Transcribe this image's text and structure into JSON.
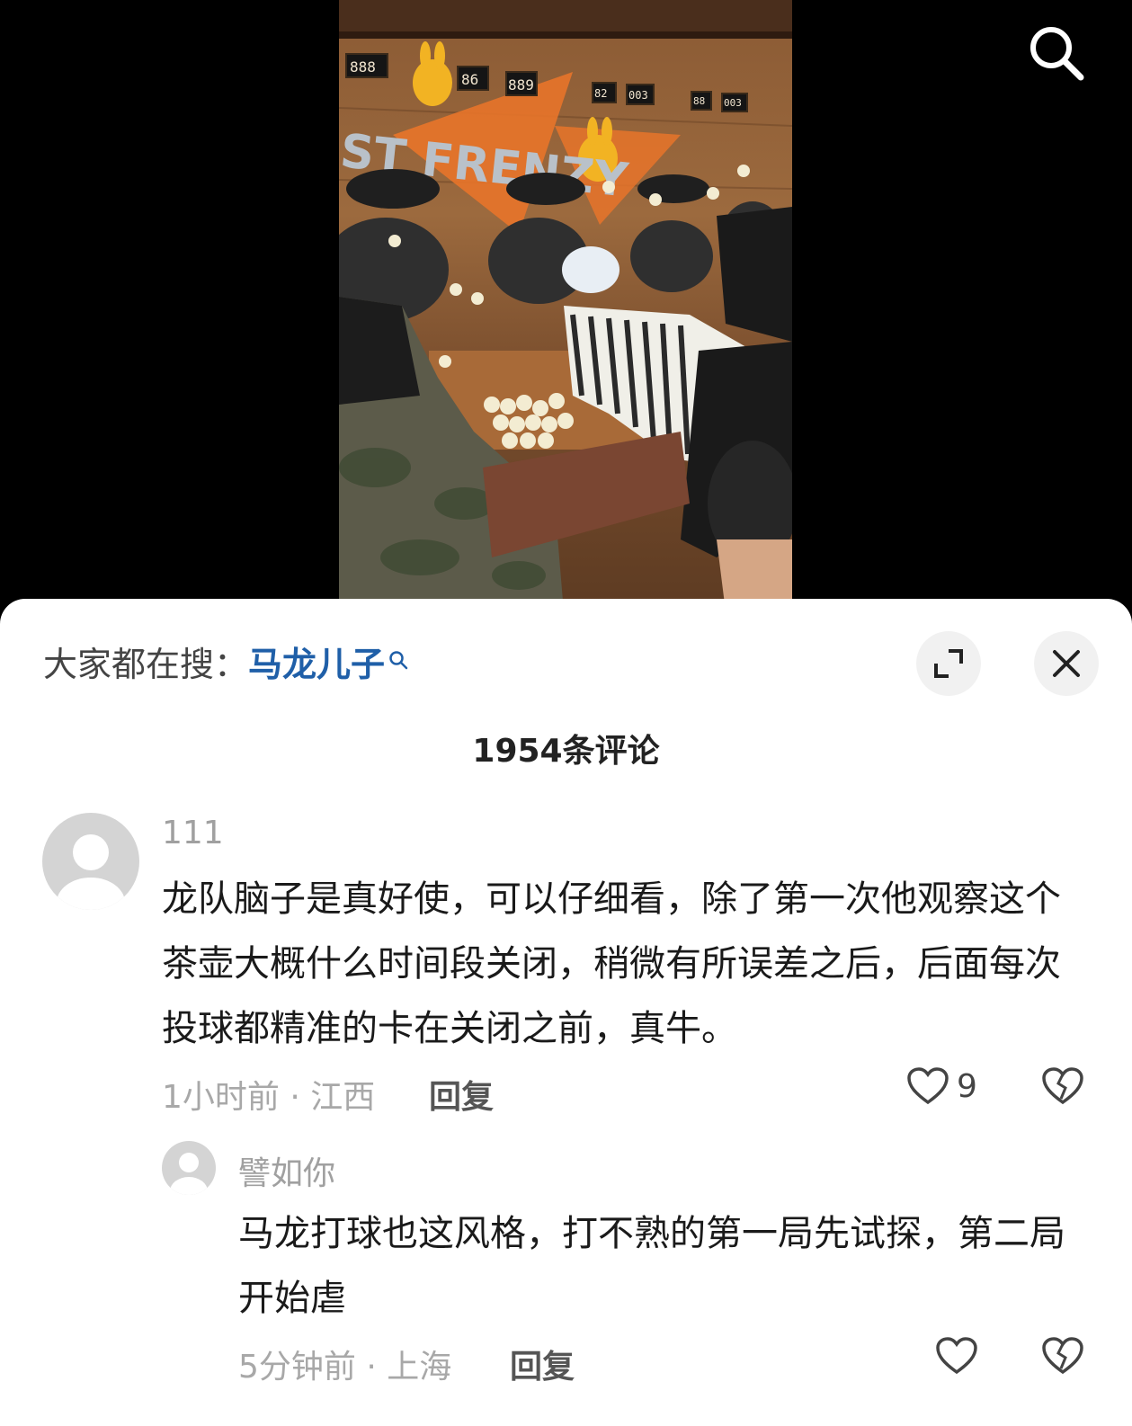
{
  "search": {
    "icon": "search-icon"
  },
  "video": {
    "scene": [
      "888",
      "86",
      "889",
      "82",
      "003",
      "88",
      "003"
    ],
    "sign_text": "ST FRENZY"
  },
  "sheet": {
    "trending_prefix": "大家都在搜：",
    "trending_keyword": "马龙儿子",
    "expand_icon": "expand-icon",
    "close_icon": "close-icon",
    "comment_count": "1954条评论"
  },
  "comments": [
    {
      "username": "111",
      "text": "龙队脑子是真好使，可以仔细看，除了第一次他观察这个茶壶大概什么时间段关闭，稍微有所误差之后，后面每次投球都精准的卡在关闭之前，真牛。",
      "meta": "1小时前 · 江西",
      "reply_label": "回复",
      "likes": "9"
    },
    {
      "username": "譬如你",
      "text": "马龙打球也这风格，打不熟的第一局先试探，第二局开始虐",
      "meta": "5分钟前 · 上海",
      "reply_label": "回复",
      "likes": ""
    }
  ],
  "colors": {
    "keyword": "#1f5fa8",
    "sheet_bg": "#ffffff",
    "muted": "#a8a8a8"
  }
}
